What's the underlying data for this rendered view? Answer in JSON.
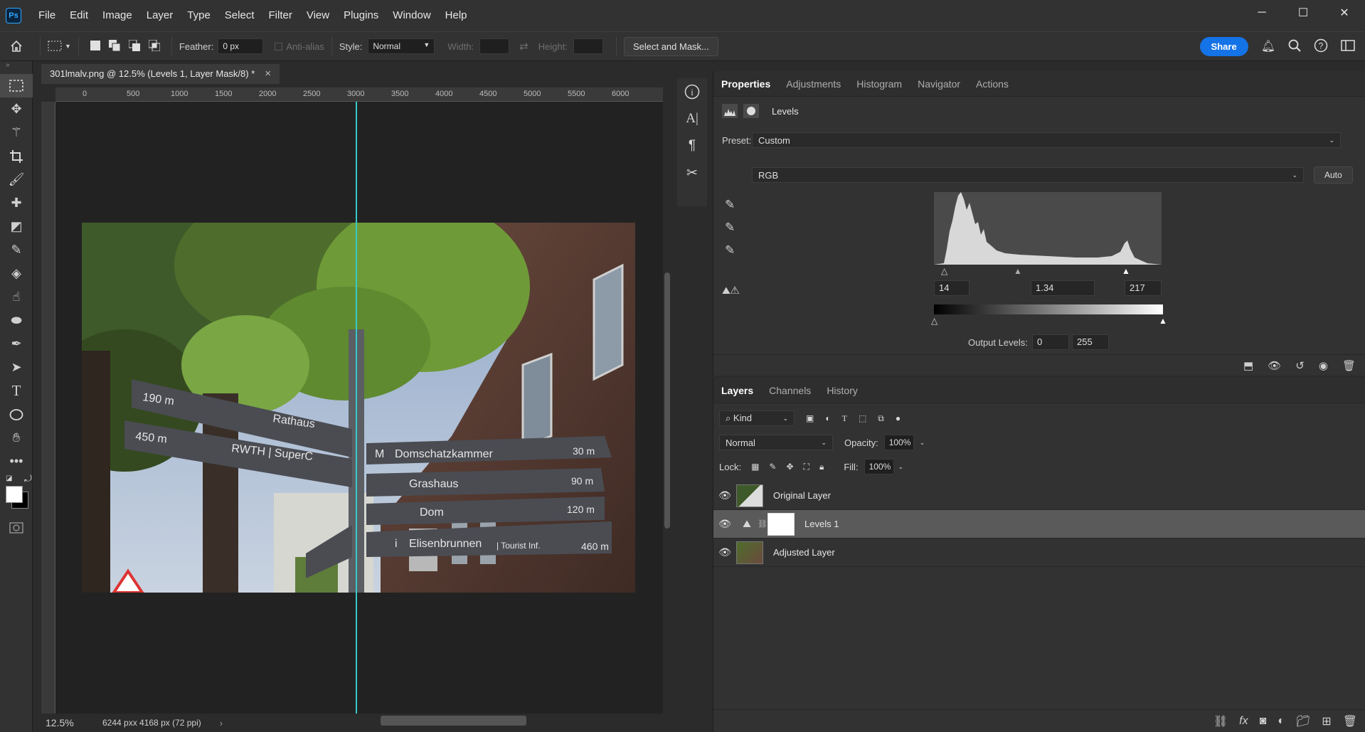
{
  "app": {
    "logo": "Ps"
  },
  "menu": [
    "File",
    "Edit",
    "Image",
    "Layer",
    "Type",
    "Select",
    "Filter",
    "View",
    "Plugins",
    "Window",
    "Help"
  ],
  "window_controls": {
    "minimize": "─",
    "maximize": "☐",
    "close": "✕"
  },
  "options": {
    "feather_label": "Feather:",
    "feather_value": "0 px",
    "antialias_label": "Anti-alias",
    "style_label": "Style:",
    "style_value": "Normal",
    "width_label": "Width:",
    "height_label": "Height:",
    "select_mask": "Select and Mask...",
    "share": "Share"
  },
  "document": {
    "tab_title": "301lmalv.png @ 12.5% (Levels 1, Layer Mask/8) *",
    "close": "×",
    "ruler_ticks": [
      "0",
      "500",
      "1000",
      "1500",
      "2000",
      "2500",
      "3000",
      "3500",
      "4000",
      "4500",
      "5000",
      "5500",
      "6000"
    ],
    "zoom": "12.5%",
    "doc_size": "6244 pxx 4168 px (72 ppi)"
  },
  "signs": {
    "left_top_dist": "190 m",
    "left_top_name": "Rathaus",
    "left_bottom_dist": "450 m",
    "left_bottom_name": "RWTH | SuperC",
    "right": [
      {
        "prefix": "M",
        "name": "Domschatzkammer",
        "dist": "30 m"
      },
      {
        "prefix": "",
        "name": "Grashaus",
        "dist": "90 m"
      },
      {
        "prefix": "",
        "name": "Dom",
        "dist": "120 m"
      },
      {
        "prefix": "i",
        "name": "Elisenbrunnen",
        "suffix": "| Tourist Inf.",
        "dist": "460 m"
      }
    ]
  },
  "properties": {
    "tabs": [
      "Properties",
      "Adjustments",
      "Histogram",
      "Navigator",
      "Actions"
    ],
    "active_tab": "Properties",
    "adjustment_name": "Levels",
    "preset_label": "Preset:",
    "preset_value": "Custom",
    "channel": "RGB",
    "auto": "Auto",
    "input_black": "14",
    "input_gamma": "1.34",
    "input_white": "217",
    "output_label": "Output Levels:",
    "output_black": "0",
    "output_white": "255"
  },
  "layers": {
    "tabs": [
      "Layers",
      "Channels",
      "History"
    ],
    "filter_kind": "Kind",
    "blend_mode": "Normal",
    "opacity_label": "Opacity:",
    "opacity": "100%",
    "lock_label": "Lock:",
    "fill_label": "Fill:",
    "fill": "100%",
    "items": [
      {
        "name": "Original Layer",
        "selected": false
      },
      {
        "name": "Levels 1",
        "selected": true
      },
      {
        "name": "Adjusted Layer",
        "selected": false
      }
    ]
  },
  "colors": {
    "accent": "#1473e6",
    "guide": "#35c9c9",
    "panel_bg": "#323232",
    "canvas_bg": "#222222"
  }
}
